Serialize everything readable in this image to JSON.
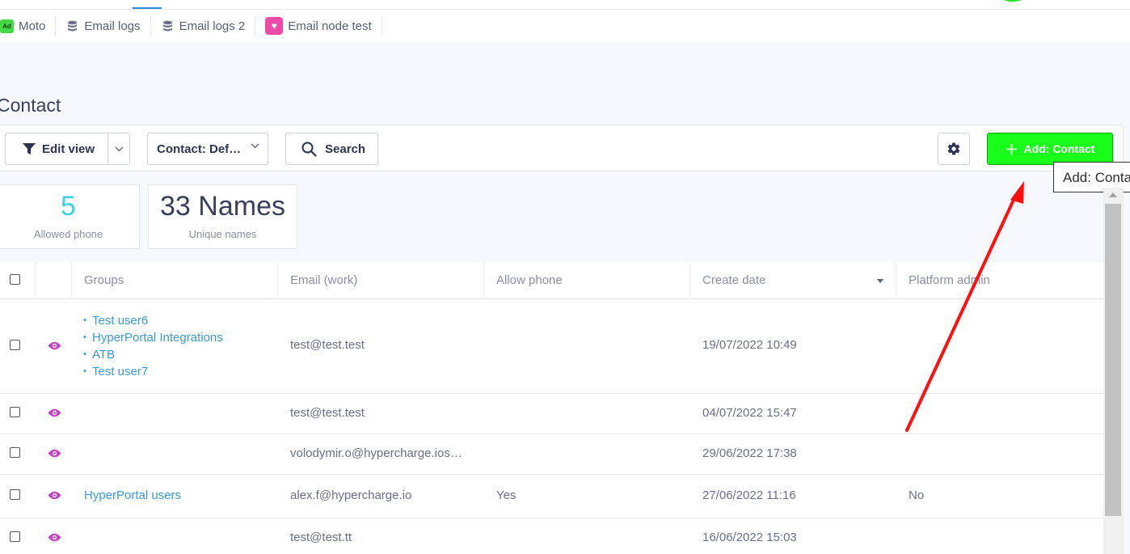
{
  "tabs": [
    {
      "label": "Moto",
      "icon": "ad-badge-icon",
      "badge": "Ad"
    },
    {
      "label": "Email logs",
      "icon": "database-icon"
    },
    {
      "label": "Email logs 2",
      "icon": "database-icon"
    },
    {
      "label": "Email node test",
      "icon": "pink-app-icon"
    }
  ],
  "page": {
    "title": "Contact"
  },
  "toolbar": {
    "edit_view_label": "Edit view",
    "view_select_value": "Contact: Def…",
    "search_label": "Search",
    "add_label": "Add: Contact",
    "add_color": "#1aff1a"
  },
  "tooltip": {
    "text": "Add: Contact"
  },
  "stats": [
    {
      "value": "5",
      "label": "Allowed phone",
      "color": "#37d5e0"
    },
    {
      "value": "33 Names",
      "label": "Unique names"
    }
  ],
  "table": {
    "columns": [
      "Groups",
      "Email (work)",
      "Allow phone",
      "Create date",
      "Platform admin"
    ],
    "sort_column": "Create date",
    "rows": [
      {
        "groups": [
          "Test user6",
          "HyperPortal Integrations",
          "ATB",
          "Test user7"
        ],
        "email": "test@test.test",
        "allow_phone": "",
        "create_date": "19/07/2022 10:49",
        "platform_admin": ""
      },
      {
        "groups": [],
        "email": "test@test.test",
        "allow_phone": "",
        "create_date": "04/07/2022 15:47",
        "platform_admin": ""
      },
      {
        "groups": [],
        "email": "volodymir.o@hypercharge.ios…",
        "allow_phone": "",
        "create_date": "29/06/2022 17:38",
        "platform_admin": ""
      },
      {
        "groups_text": "HyperPortal users",
        "email": "alex.f@hypercharge.io",
        "allow_phone": "Yes",
        "create_date": "27/06/2022 11:16",
        "platform_admin": "No"
      },
      {
        "groups": [],
        "email": "test@test.tt",
        "allow_phone": "",
        "create_date": "16/06/2022 15:03",
        "platform_admin": ""
      }
    ]
  },
  "colors": {
    "accent": "#3a9ad9",
    "eye": "#c43fc4",
    "arrow": "#ff0f0f"
  }
}
